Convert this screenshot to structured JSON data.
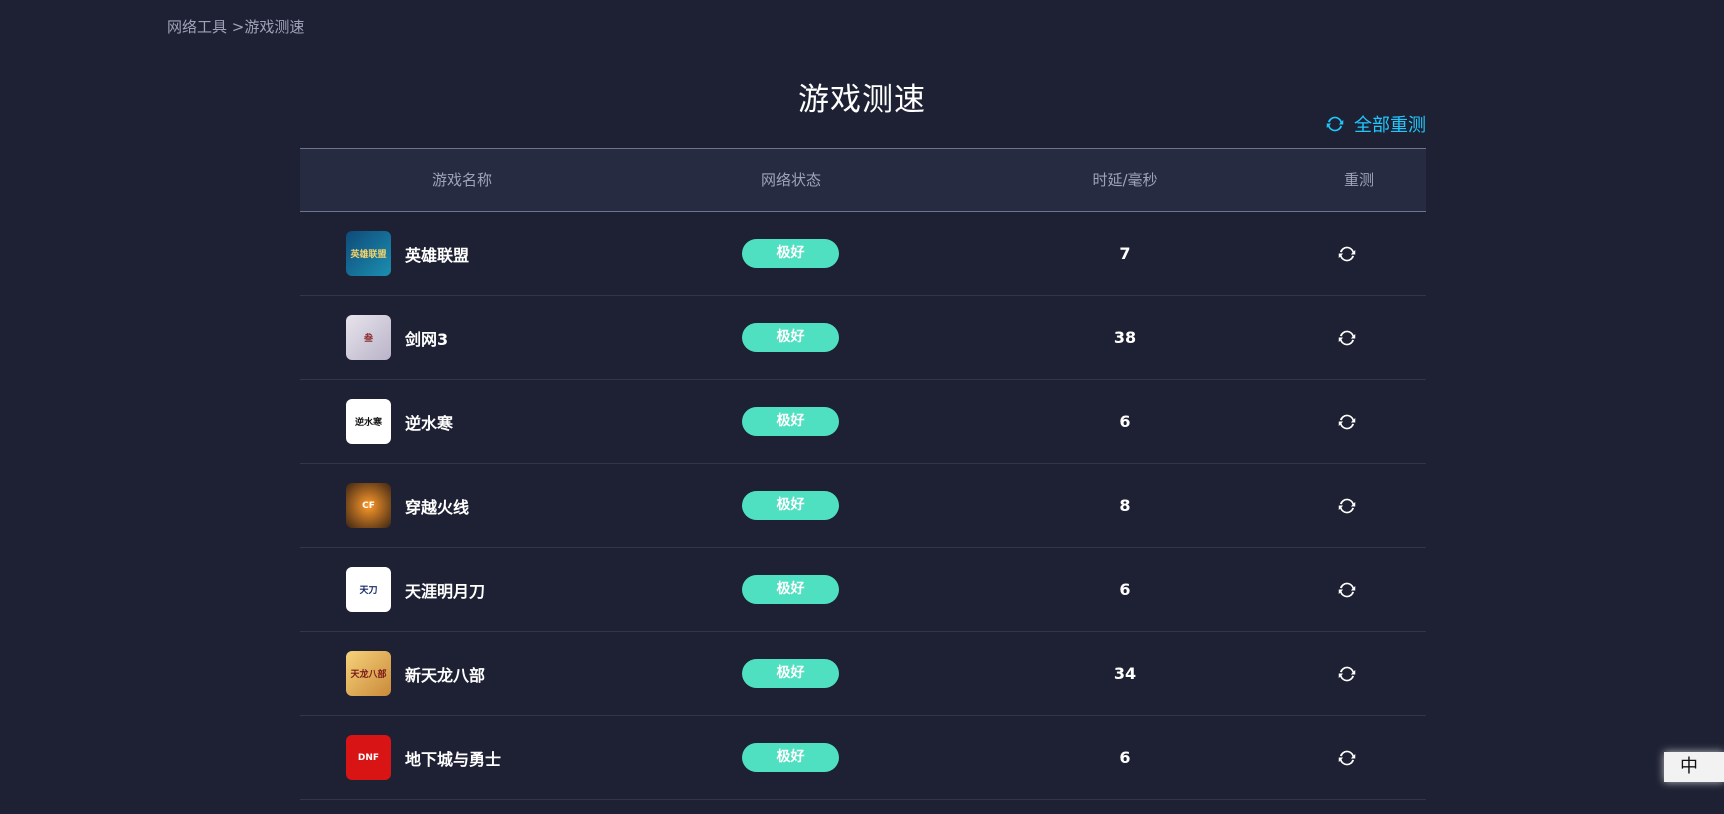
{
  "breadcrumb": {
    "parent": "网络工具",
    "separator": " >",
    "current": "游戏测速"
  },
  "page_title": "游戏测速",
  "retest_all_label": "全部重测",
  "table": {
    "headers": {
      "name": "游戏名称",
      "status": "网络状态",
      "delay": "时延/毫秒",
      "retest": "重测"
    },
    "rows": [
      {
        "name": "英雄联盟",
        "status": "极好",
        "delay": "7",
        "icon_text": "英雄联盟",
        "icon": "lol-icon"
      },
      {
        "name": "剑网3",
        "status": "极好",
        "delay": "38",
        "icon_text": "叁",
        "icon": "jx3-icon"
      },
      {
        "name": "逆水寒",
        "status": "极好",
        "delay": "6",
        "icon_text": "逆水寒",
        "icon": "nsh-icon"
      },
      {
        "name": "穿越火线",
        "status": "极好",
        "delay": "8",
        "icon_text": "CF",
        "icon": "cf-icon"
      },
      {
        "name": "天涯明月刀",
        "status": "极好",
        "delay": "6",
        "icon_text": "天刀",
        "icon": "tymyd-icon"
      },
      {
        "name": "新天龙八部",
        "status": "极好",
        "delay": "34",
        "icon_text": "天龙八部",
        "icon": "tlbb-icon"
      },
      {
        "name": "地下城与勇士",
        "status": "极好",
        "delay": "6",
        "icon_text": "DNF",
        "icon": "dnf-icon"
      }
    ]
  },
  "ime_indicator": "中",
  "colors": {
    "background": "#1e2133",
    "accent": "#1ec8ff",
    "status_excellent": "#4fe0c1"
  }
}
